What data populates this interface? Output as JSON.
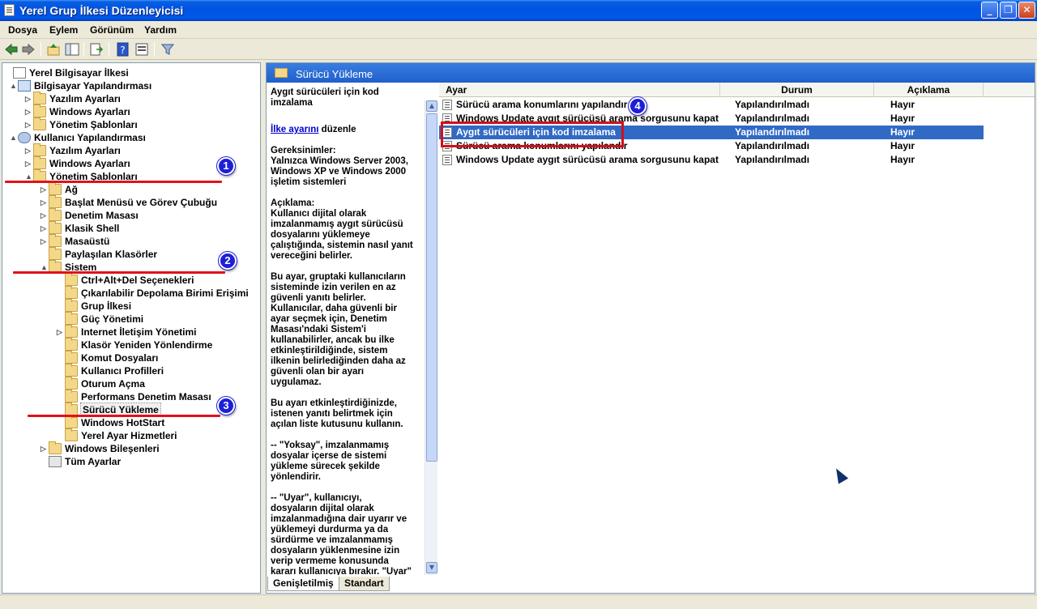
{
  "window": {
    "title": "Yerel Grup İlkesi Düzenleyicisi"
  },
  "menu": [
    "Dosya",
    "Eylem",
    "Görünüm",
    "Yardım"
  ],
  "tree": [
    {
      "label": "Yerel Bilgisayar İlkesi",
      "icon": "doc",
      "exp": ""
    },
    {
      "label": "Bilgisayar Yapılandırması",
      "icon": "computer",
      "exp": "▲"
    },
    {
      "label": "Yazılım Ayarları",
      "icon": "folder",
      "exp": "▷"
    },
    {
      "label": "Windows Ayarları",
      "icon": "folder",
      "exp": "▷"
    },
    {
      "label": "Yönetim Şablonları",
      "icon": "folder",
      "exp": "▷"
    },
    {
      "label": "Kullanıcı Yapılandırması",
      "icon": "user",
      "exp": "▲"
    },
    {
      "label": "Yazılım Ayarları",
      "icon": "folder",
      "exp": "▷"
    },
    {
      "label": "Windows Ayarları",
      "icon": "folder",
      "exp": "▷"
    },
    {
      "label": "Yönetim Şablonları",
      "icon": "folder",
      "exp": "▲"
    },
    {
      "label": "Ağ",
      "icon": "folder",
      "exp": "▷"
    },
    {
      "label": "Başlat Menüsü ve Görev Çubuğu",
      "icon": "folder",
      "exp": "▷"
    },
    {
      "label": "Denetim Masası",
      "icon": "folder",
      "exp": "▷"
    },
    {
      "label": "Klasik Shell",
      "icon": "folder",
      "exp": "▷"
    },
    {
      "label": "Masaüstü",
      "icon": "folder",
      "exp": "▷"
    },
    {
      "label": "Paylaşılan Klasörler",
      "icon": "folder",
      "exp": ""
    },
    {
      "label": "Sistem",
      "icon": "folder",
      "exp": "▲"
    },
    {
      "label": "Ctrl+Alt+Del Seçenekleri",
      "icon": "folder",
      "exp": ""
    },
    {
      "label": "Çıkarılabilir Depolama Birimi Erişimi",
      "icon": "folder",
      "exp": ""
    },
    {
      "label": "Grup İlkesi",
      "icon": "folder",
      "exp": ""
    },
    {
      "label": "Güç Yönetimi",
      "icon": "folder",
      "exp": ""
    },
    {
      "label": "Internet İletişim Yönetimi",
      "icon": "folder",
      "exp": "▷"
    },
    {
      "label": "Klasör Yeniden Yönlendirme",
      "icon": "folder",
      "exp": ""
    },
    {
      "label": "Komut Dosyaları",
      "icon": "folder",
      "exp": ""
    },
    {
      "label": "Kullanıcı Profilleri",
      "icon": "folder",
      "exp": ""
    },
    {
      "label": "Oturum Açma",
      "icon": "folder",
      "exp": ""
    },
    {
      "label": "Performans Denetim Masası",
      "icon": "folder",
      "exp": ""
    },
    {
      "label": "Sürücü Yükleme",
      "icon": "folder",
      "exp": "",
      "selected": true
    },
    {
      "label": "Windows HotStart",
      "icon": "folder",
      "exp": ""
    },
    {
      "label": "Yerel Ayar Hizmetleri",
      "icon": "folder",
      "exp": ""
    },
    {
      "label": "Windows Bileşenleri",
      "icon": "folder",
      "exp": "▷"
    },
    {
      "label": "Tüm Ayarlar",
      "icon": "allset",
      "exp": ""
    }
  ],
  "right_header": "Sürücü Yükleme",
  "description": {
    "title": "Aygıt sürücüleri için kod imzalama",
    "edit_link": "İlke ayarını",
    "edit_suffix": " düzenle",
    "requirements": "Gereksinimler:\nYalnızca Windows Server 2003,\nWindows XP ve Windows 2000\nişletim sistemleri",
    "explanation": "Açıklama:\nKullanıcı dijital olarak\nimzalanmamış aygıt sürücüsü\ndosyalarını yüklemeye\nçalıştığında, sistemin nasıl yanıt\nvereceğini belirler.",
    "para2": "Bu ayar, gruptaki kullanıcıların\nsisteminde izin verilen en az\ngüvenli yanıtı belirler.\nKullanıcılar, daha güvenli bir\nayar seçmek için, Denetim\nMasası'ndaki Sistem'i\nkullanabilirler, ancak bu ilke\netkinleştirildiğinde, sistem\nilkenin belirlediğinden daha az\ngüvenli olan bir ayarı\nuygulamaz.",
    "para3": "Bu ayarı etkinleştirdiğinizde,\nistenen yanıtı belirtmek için\naçılan liste kutusunu kullanın.",
    "para4": "--    \"Yoksay\", imzalanmamış\ndosyalar içerse de sistemi\nyükleme sürecek şekilde\nyönlendirir.",
    "para5": "--    \"Uyar\", kullanıcıyı,\ndosyaların dijital olarak\nimzalanmadığına dair uyarır ve\nyüklemeyi durdurma ya da\nsürdürme ve imzalanmamış\ndosyaların yüklenmesine izin\nverip vermeme konusunda\nkararı kullanıcıya bırakır. \"Uyar\"\nvarsayılan değerdir."
  },
  "columns": {
    "setting": "Ayar",
    "state": "Durum",
    "comment": "Açıklama"
  },
  "settings": [
    {
      "name": "Sürücü arama konumlarını yapılandır",
      "state": "Yapılandırılmadı",
      "comment": "Hayır",
      "selected": false
    },
    {
      "name": "Windows Update aygıt sürücüsü arama sorgusunu kapat",
      "state": "Yapılandırılmadı",
      "comment": "Hayır",
      "selected": false
    },
    {
      "name": "Aygıt sürücüleri için kod imzalama",
      "state": "Yapılandırılmadı",
      "comment": "Hayır",
      "selected": true
    },
    {
      "name": "Sürücü arama konumlarını yapılandır",
      "state": "Yapılandırılmadı",
      "comment": "Hayır",
      "selected": false
    },
    {
      "name": "Windows Update aygıt sürücüsü arama sorgusunu kapat",
      "state": "Yapılandırılmadı",
      "comment": "Hayır",
      "selected": false
    }
  ],
  "tabs": [
    "Genişletilmiş",
    "Standart"
  ],
  "annotations": {
    "badge1": "1",
    "badge2": "2",
    "badge3": "3",
    "badge4": "4"
  },
  "colors": {
    "selection": "#316ac5",
    "annotation_red": "#e2101a",
    "badge_blue": "#1d1fd8"
  }
}
